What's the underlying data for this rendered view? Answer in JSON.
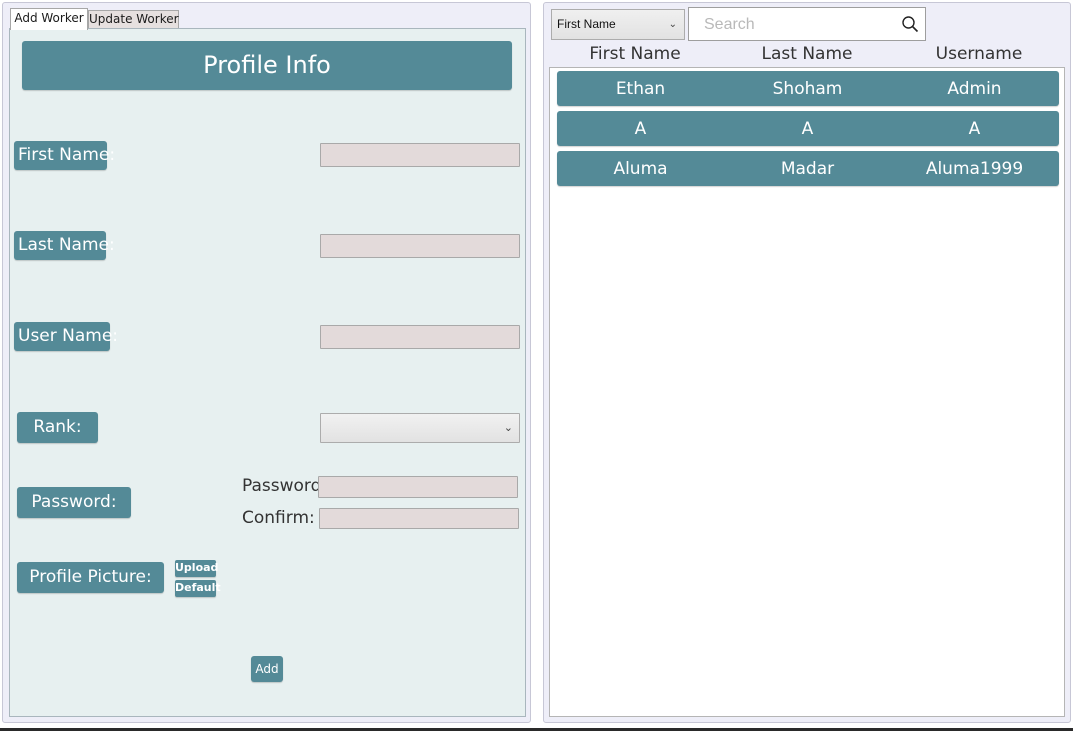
{
  "tabs": [
    {
      "label": "Add Worker",
      "active": true
    },
    {
      "label": "Update Worker",
      "active": false
    }
  ],
  "form": {
    "header": "Profile Info",
    "first_name_label": "First Name:",
    "last_name_label": "Last Name:",
    "user_name_label": "User Name:",
    "rank_label": "Rank:",
    "password_label": "Password:",
    "profile_picture_label": "Profile Picture:",
    "password_field_label": "Password:",
    "confirm_field_label": "Confirm:",
    "first_name_value": "",
    "last_name_value": "",
    "user_name_value": "",
    "rank_value": "",
    "password_value": "",
    "confirm_value": "",
    "upload_button": "Upload",
    "default_button": "Default",
    "add_button": "Add"
  },
  "list": {
    "filter": {
      "selected": "First Name",
      "icon": "chevron-down-icon"
    },
    "search": {
      "placeholder": "Search",
      "value": "",
      "icon": "search-icon"
    },
    "columns": [
      "First Name",
      "Last Name",
      "Username"
    ],
    "rows": [
      {
        "first": "Ethan",
        "last": "Shoham",
        "username": "Admin"
      },
      {
        "first": "A",
        "last": "A",
        "username": "A"
      },
      {
        "first": "Aluma",
        "last": "Madar",
        "username": "Aluma1999"
      }
    ]
  },
  "colors": {
    "accent": "#548a97",
    "panel_bg": "#e7f0f0",
    "field_bg": "#e3dada",
    "frame_bg": "#eeeef8"
  }
}
